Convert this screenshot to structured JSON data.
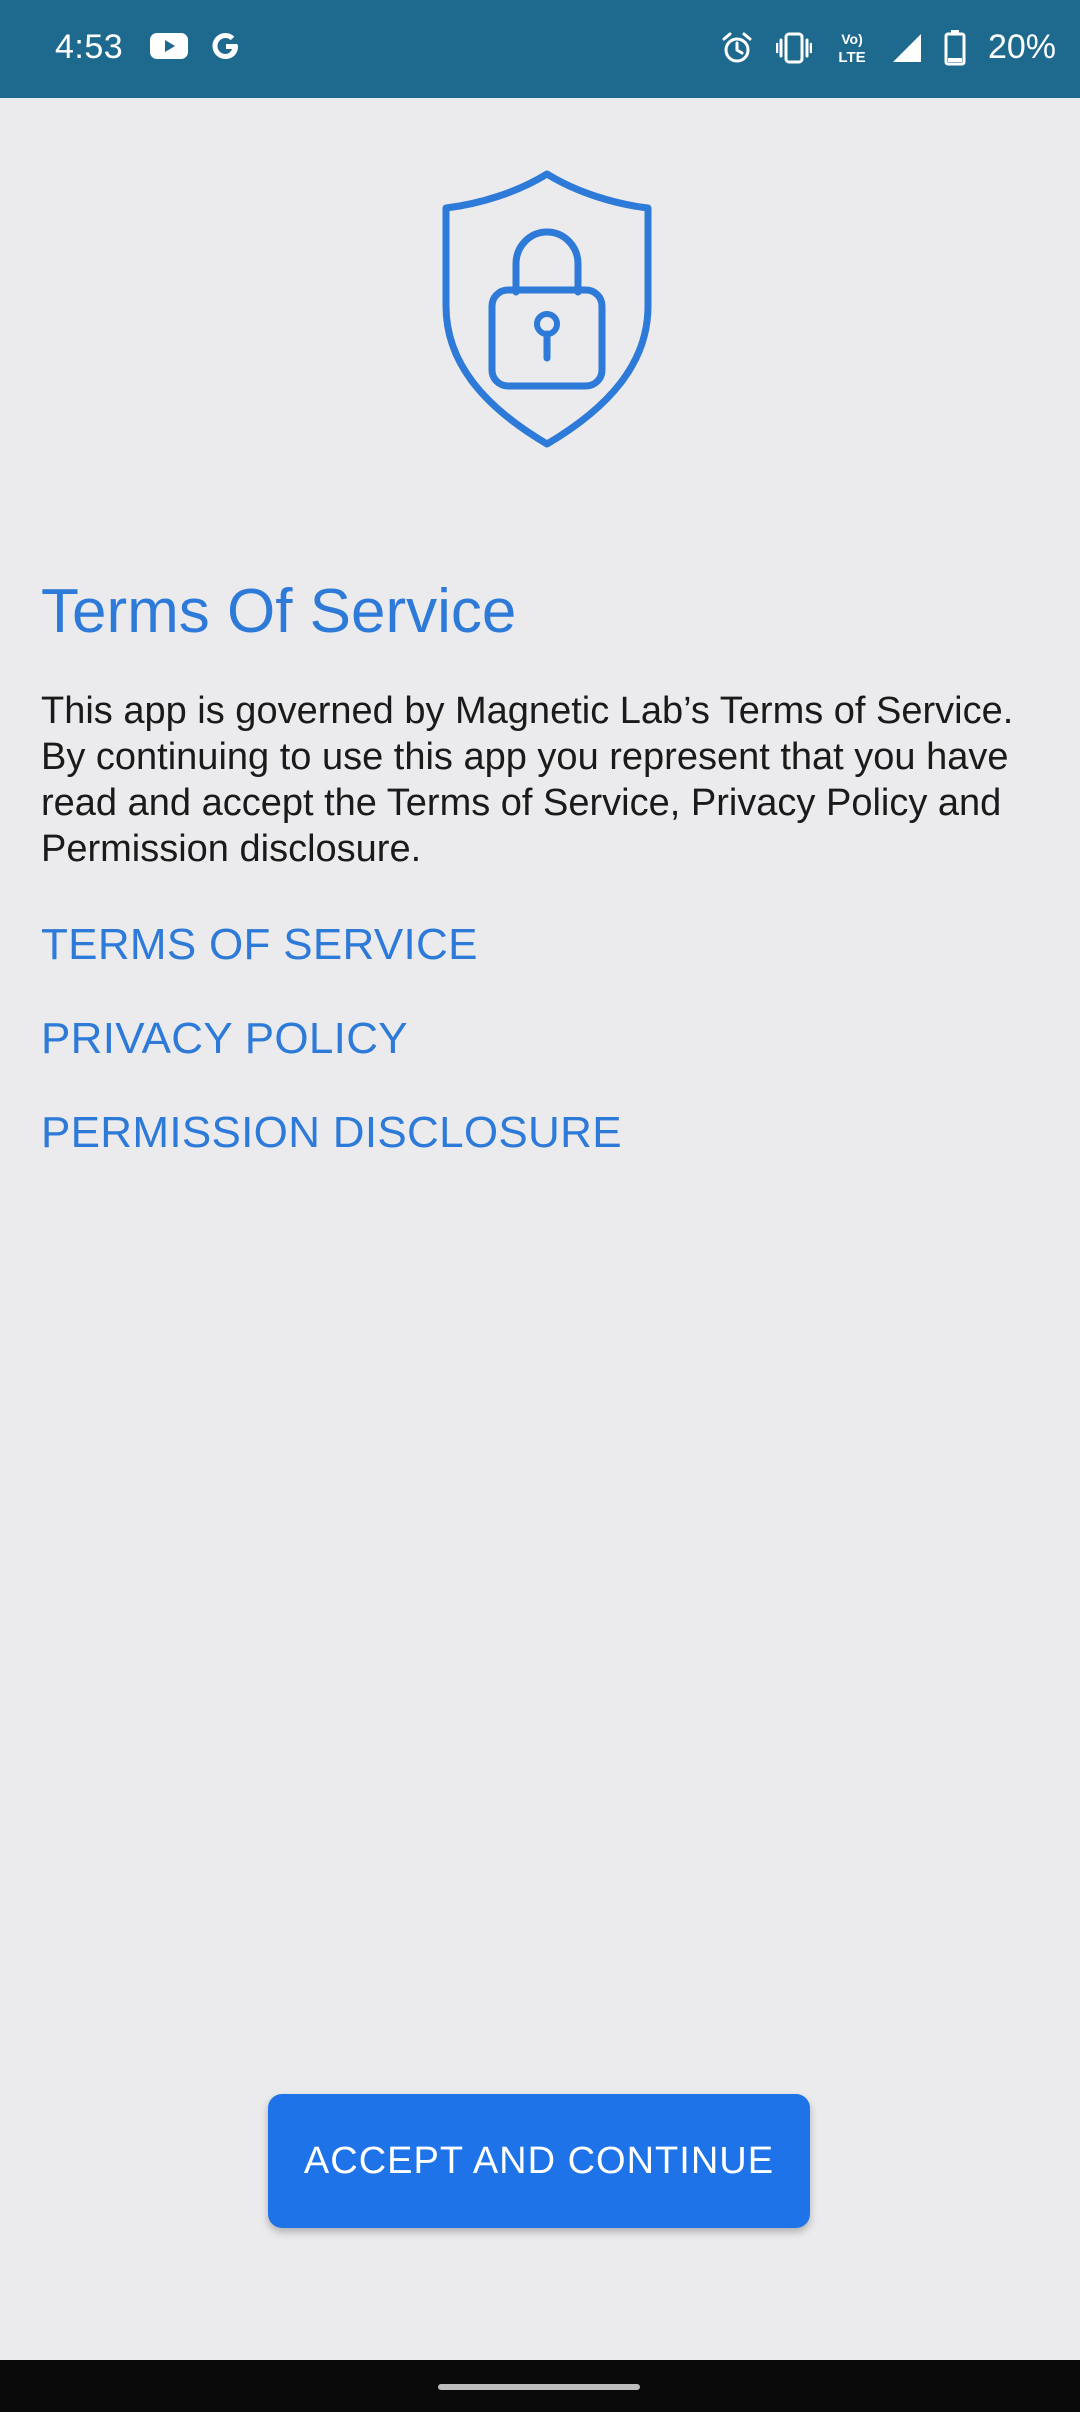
{
  "status_bar": {
    "time": "4:53",
    "battery_percent": "20%",
    "icons": [
      "youtube-icon",
      "google-icon",
      "alarm-icon",
      "vibrate-icon",
      "volte-icon",
      "signal-icon",
      "battery-icon"
    ],
    "volte_label_top": "Vo)",
    "volte_label_bottom": "LTE",
    "background_color": "#1d6a8e"
  },
  "content": {
    "hero_icon": "shield-lock-icon",
    "title": "Terms Of Service",
    "body": "This app is governed by Magnetic Lab’s Terms of Service. By continuing to use this app you represent that you have read and accept the Terms of Service, Privacy Policy and Permission disclosure.",
    "links": {
      "terms": "TERMS OF SERVICE",
      "privacy": "PRIVACY POLICY",
      "permission": "PERMISSION DISCLOSURE"
    },
    "accent_color": "#2e7ad8"
  },
  "actions": {
    "accept_label": "ACCEPT AND CONTINUE",
    "button_color": "#1e73e8"
  }
}
